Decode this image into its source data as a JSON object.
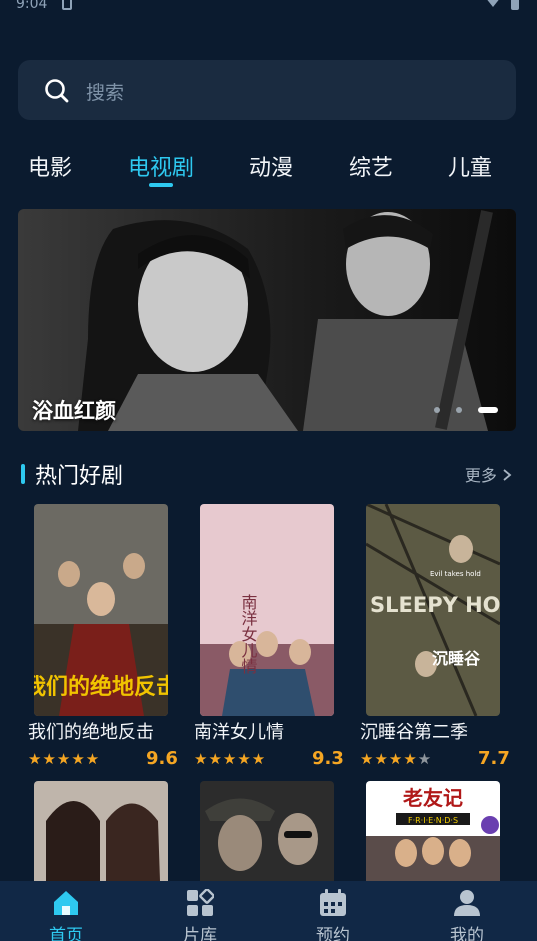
{
  "status": {
    "time": "9:04"
  },
  "search": {
    "placeholder": "搜索"
  },
  "tabs": [
    {
      "label": "电影"
    },
    {
      "label": "电视剧",
      "active": true
    },
    {
      "label": "动漫"
    },
    {
      "label": "综艺"
    },
    {
      "label": "儿童"
    }
  ],
  "banner": {
    "title": "浴血红颜",
    "page_count": 3,
    "current_page": 3
  },
  "section": {
    "title": "热门好剧",
    "more": "更多"
  },
  "cards": [
    {
      "title": "我们的绝地反击",
      "rating": "9.6",
      "stars": 5,
      "poster_text": "我们的绝地反击"
    },
    {
      "title": "南洋女儿情",
      "rating": "9.3",
      "stars": 5,
      "poster_text": "南洋女儿情"
    },
    {
      "title": "沉睡谷第二季",
      "rating": "7.7",
      "stars": 4,
      "poster_text": "SLEEPY HOLLOW",
      "poster_subtext": "沉睡谷",
      "poster_tagline": "Evil takes hold"
    },
    {
      "title": "",
      "rating": "",
      "stars": 0
    },
    {
      "title": "",
      "rating": "",
      "stars": 0
    },
    {
      "title": "",
      "rating": "",
      "stars": 0,
      "poster_text": "老友记",
      "poster_subtext": "F·R·I·E·N·D·S"
    }
  ],
  "bottom_nav": [
    {
      "label": "首页",
      "icon": "home-icon",
      "active": true
    },
    {
      "label": "片库",
      "icon": "library-icon"
    },
    {
      "label": "预约",
      "icon": "calendar-icon"
    },
    {
      "label": "我的",
      "icon": "profile-icon"
    }
  ],
  "colors": {
    "accent": "#2ec9f0",
    "background": "#0b1b2f",
    "rating": "#f5a623",
    "nav_background": "#112846"
  }
}
